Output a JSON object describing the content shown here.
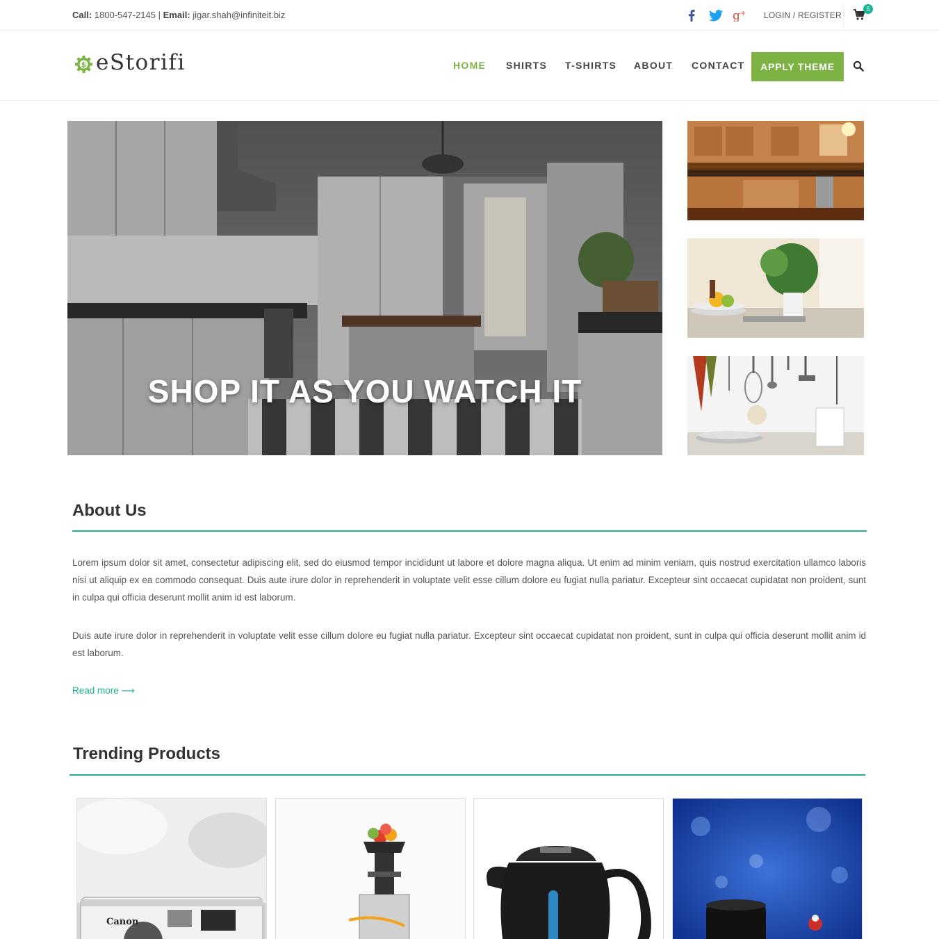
{
  "topbar": {
    "call_label": "Call:",
    "phone": "1800-547-2145",
    "separator": "|",
    "email_label": "Email:",
    "email": "jigar.shah@infiniteit.biz",
    "login_label": "LOGIN / REGISTER",
    "cart_count": "5",
    "social": [
      "facebook-icon",
      "twitter-icon",
      "google-plus-icon"
    ]
  },
  "header": {
    "logo": "eStorifi",
    "nav": [
      "HOME",
      "SHIRTS",
      "T-SHIRTS",
      "ABOUT",
      "CONTACT"
    ],
    "active_nav": "HOME",
    "apply_label": "APPLY THEME"
  },
  "hero": {
    "caption": "SHOP IT AS YOU WATCH IT"
  },
  "about": {
    "title": "About Us",
    "paragraph1": "Lorem ipsum dolor sit amet, consectetur adipiscing elit, sed do eiusmod tempor incididunt ut labore et dolore magna aliqua. Ut enim ad minim veniam, quis nostrud exercitation ullamco laboris nisi ut aliquip ex ea commodo consequat. Duis aute irure dolor in reprehenderit in voluptate velit esse cillum dolore eu fugiat nulla pariatur. Excepteur sint occaecat cupidatat non proident, sunt in culpa qui officia deserunt mollit anim id est laborum.",
    "paragraph2": "Duis aute irure dolor in reprehenderit in voluptate velit esse cillum dolore eu fugiat nulla pariatur. Excepteur sint occaecat cupidatat non proident, sunt in culpa qui officia deserunt mollit anim id est laborum.",
    "read_more": "Read more ⟶"
  },
  "trending": {
    "title": "Trending Products",
    "camera_brand": "Canon"
  },
  "colors": {
    "accent_green": "#7cb342",
    "accent_teal": "#1fb394",
    "facebook": "#3b5998",
    "twitter": "#1da1f2",
    "google_plus": "#dd4b39"
  }
}
